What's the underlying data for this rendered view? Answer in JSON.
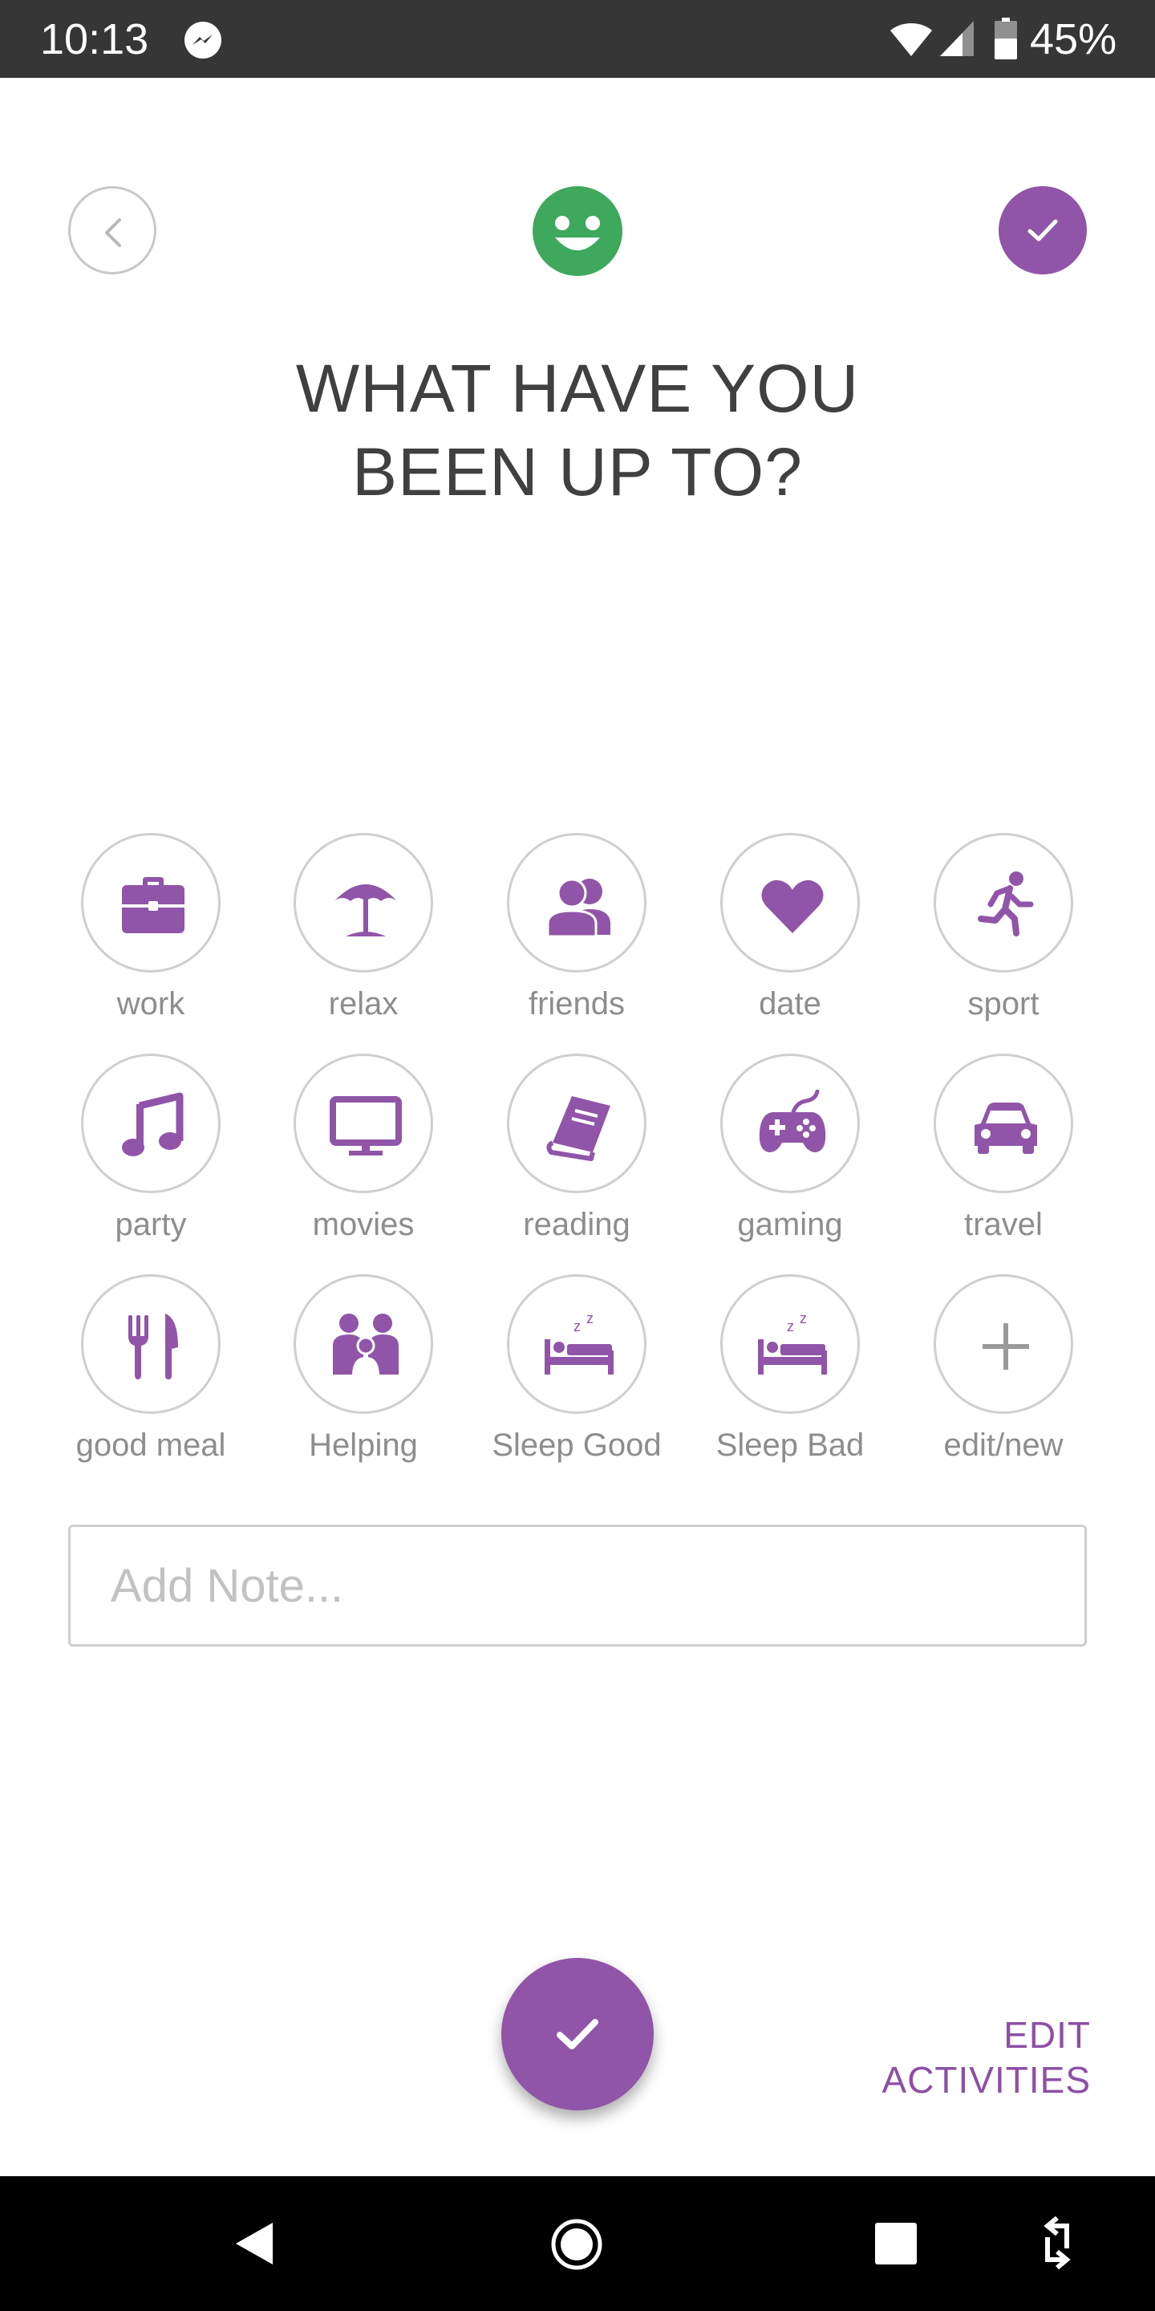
{
  "status_bar": {
    "time": "10:13",
    "battery": "45%",
    "icons": [
      "messenger-icon",
      "wifi-icon",
      "cell-signal-icon",
      "battery-icon"
    ]
  },
  "header": {
    "title_line1": "WHAT HAVE YOU",
    "title_line2": "BEEN UP TO?",
    "back_icon": "chevron-left-icon",
    "mood_icon": "happy-face-icon",
    "confirm_icon": "check-icon"
  },
  "activities": [
    {
      "label": "work",
      "icon": "briefcase-icon"
    },
    {
      "label": "relax",
      "icon": "beach-umbrella-icon"
    },
    {
      "label": "friends",
      "icon": "people-icon"
    },
    {
      "label": "date",
      "icon": "heart-icon"
    },
    {
      "label": "sport",
      "icon": "running-icon"
    },
    {
      "label": "party",
      "icon": "music-note-icon"
    },
    {
      "label": "movies",
      "icon": "monitor-icon"
    },
    {
      "label": "reading",
      "icon": "book-icon"
    },
    {
      "label": "gaming",
      "icon": "gamepad-icon"
    },
    {
      "label": "travel",
      "icon": "car-icon"
    },
    {
      "label": "good meal",
      "icon": "fork-knife-icon"
    },
    {
      "label": "Helping",
      "icon": "family-icon"
    },
    {
      "label": "Sleep Good",
      "icon": "bed-icon"
    },
    {
      "label": "Sleep Bad",
      "icon": "bed-icon"
    },
    {
      "label": "edit/new",
      "icon": "plus-icon"
    }
  ],
  "note": {
    "placeholder": "Add Note...",
    "value": ""
  },
  "footer": {
    "edit_activities_label": "EDIT ACTIVITIES",
    "save_icon": "check-icon"
  },
  "colors": {
    "accent": "#9055a8",
    "mood_green": "#3ea85d",
    "label_gray": "#8d8d8d",
    "title_text": "#404040"
  }
}
